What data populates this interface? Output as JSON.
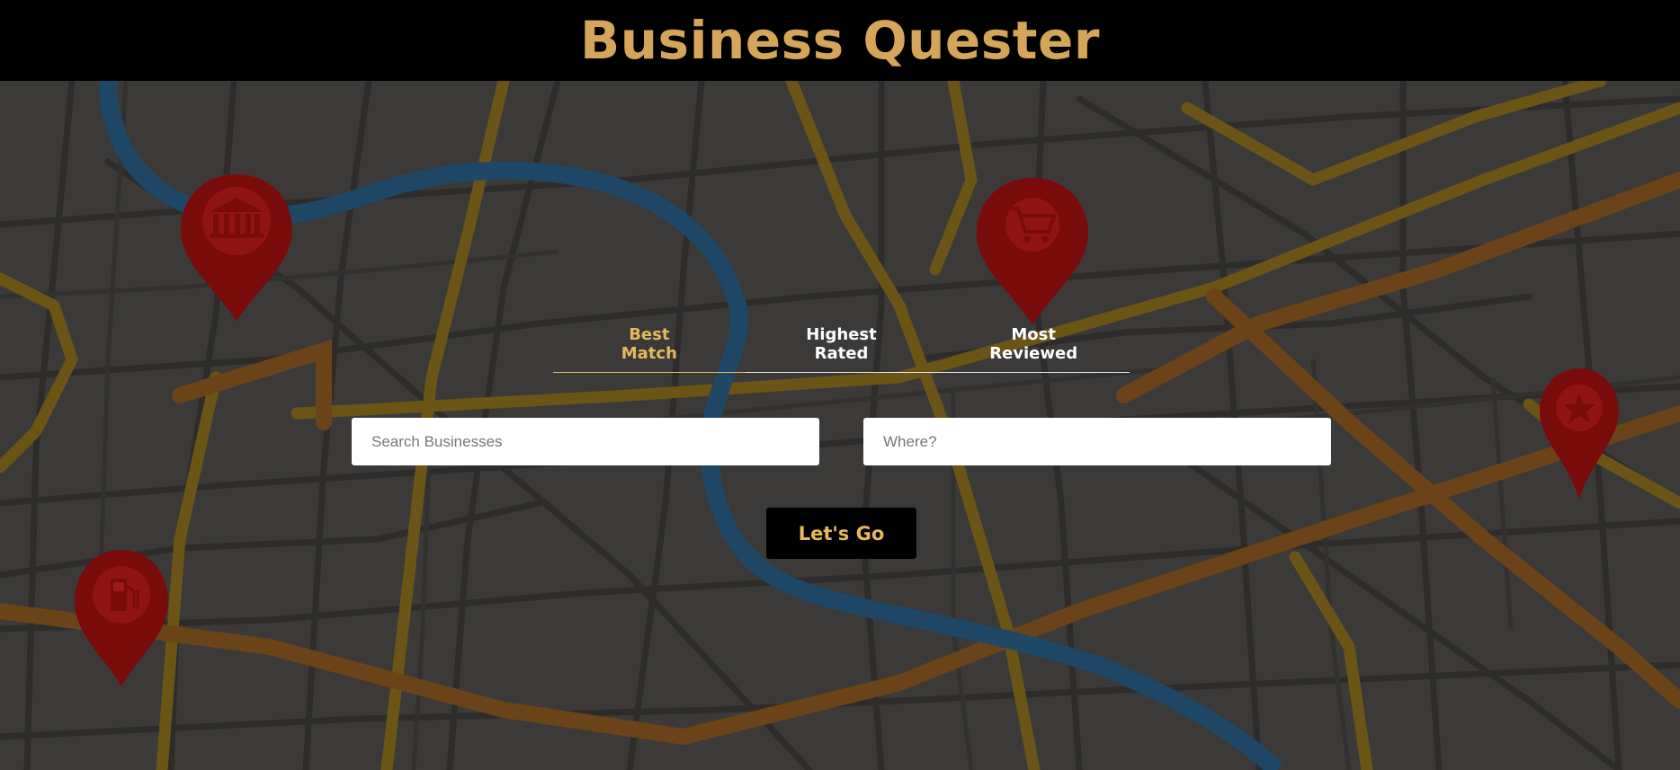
{
  "header": {
    "title": "Business Quester"
  },
  "tabs": [
    {
      "line1": "Best",
      "line2": "Match",
      "active": true
    },
    {
      "line1": "Highest",
      "line2": "Rated",
      "active": false
    },
    {
      "line1": "Most",
      "line2": "Reviewed",
      "active": false
    }
  ],
  "search": {
    "term_placeholder": "Search Businesses",
    "term_value": "",
    "location_placeholder": "Where?",
    "location_value": ""
  },
  "submit_label": "Let's Go",
  "map_pins": [
    {
      "icon": "bank-icon"
    },
    {
      "icon": "shopping-cart-icon"
    },
    {
      "icon": "star-icon"
    },
    {
      "icon": "gas-pump-icon"
    }
  ],
  "colors": {
    "accent": "#d5a559",
    "active_tab": "#e8b85c",
    "header_bg": "#000000",
    "pin": "#8b0a0a",
    "road_major": "#7a5a14",
    "river": "#1f4b6e"
  }
}
